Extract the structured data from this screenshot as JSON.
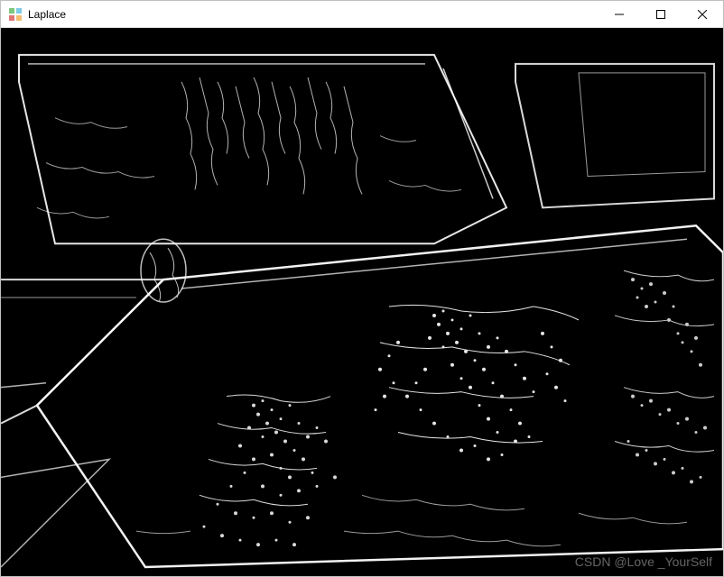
{
  "window": {
    "title": "Laplace",
    "icon_name": "opencv-icon"
  },
  "controls": {
    "minimize_label": "Minimize",
    "maximize_label": "Maximize",
    "close_label": "Close"
  },
  "content": {
    "image_type": "laplace-edge-detection",
    "description": "Black and white Laplacian edge detection output showing textured objects in rectangular containers"
  },
  "watermark": {
    "text": "CSDN @Love _YourSelf"
  }
}
